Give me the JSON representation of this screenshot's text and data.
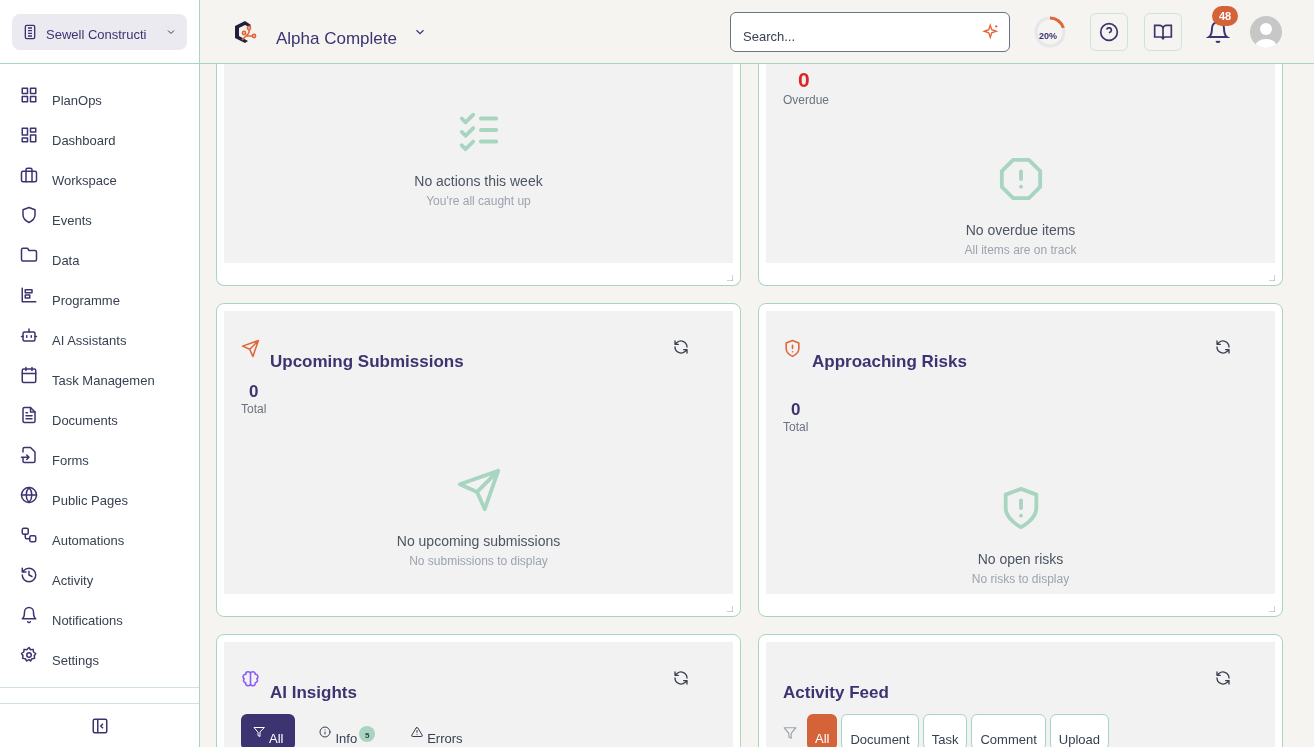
{
  "sidebar": {
    "organization": "Sewell Constructi",
    "items": [
      {
        "label": "PlanOps",
        "selected": false
      },
      {
        "label": "Dashboard",
        "selected": false
      },
      {
        "label": "Workspace",
        "selected": false
      },
      {
        "label": "Events",
        "selected": false
      },
      {
        "label": "Data",
        "selected": false
      },
      {
        "label": "Programme",
        "selected": false
      },
      {
        "label": "AI Assistants",
        "selected": false
      },
      {
        "label": "Task Managemen",
        "selected": false
      },
      {
        "label": "Documents",
        "selected": false
      },
      {
        "label": "Forms",
        "selected": false
      },
      {
        "label": "Public Pages",
        "selected": false
      },
      {
        "label": "Automations",
        "selected": false
      },
      {
        "label": "Activity",
        "selected": false
      },
      {
        "label": "Notifications",
        "selected": false
      },
      {
        "label": "Settings",
        "selected": false
      }
    ]
  },
  "header": {
    "project": "Alpha Complete",
    "search": {
      "placeholder": "Search..."
    },
    "progress": {
      "label": "20%",
      "level": 0.2
    },
    "notification_count": "48"
  },
  "cards": [
    {
      "kind": "actions",
      "empty_title": "No actions this week",
      "empty_subtitle": "You're all caught up"
    },
    {
      "kind": "overdue",
      "count": "0",
      "count_label": "Overdue",
      "empty_title": "No overdue items",
      "empty_subtitle": "All items are on track"
    },
    {
      "kind": "submissions",
      "title": "Upcoming Submissions",
      "count": "0",
      "count_label": "Total",
      "empty_title": "No upcoming submissions",
      "empty_subtitle": "No submissions to display"
    },
    {
      "kind": "risks",
      "title": "Approaching Risks",
      "count": "0",
      "count_label": "Total",
      "empty_title": "No open risks",
      "empty_subtitle": "No risks to display"
    },
    {
      "kind": "insights",
      "title": "AI Insights",
      "filters": [
        {
          "label": "All",
          "selected": true
        },
        {
          "label": "Info",
          "selected": false,
          "badge": "5"
        },
        {
          "label": "Errors",
          "selected": false
        }
      ]
    },
    {
      "kind": "feed",
      "title": "Activity Feed",
      "filters": [
        {
          "label": "All",
          "selected": true
        },
        {
          "label": "Document",
          "selected": false
        },
        {
          "label": "Task",
          "selected": false
        },
        {
          "label": "Comment",
          "selected": false
        },
        {
          "label": "Upload",
          "selected": false
        }
      ]
    }
  ]
}
